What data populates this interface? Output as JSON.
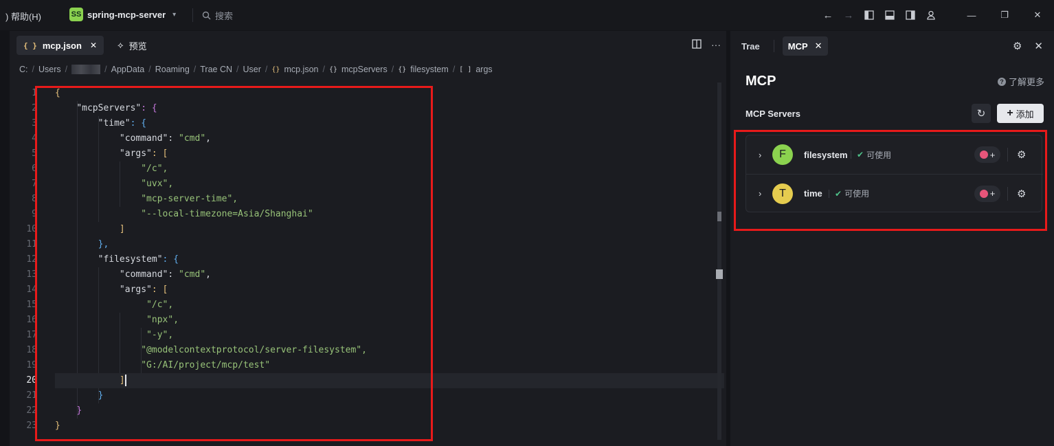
{
  "titlebar": {
    "help_menu": ") 帮助(H)",
    "project_badge": "SS",
    "project_name": "spring-mcp-server",
    "search_label": "搜索"
  },
  "editor": {
    "tabs": [
      {
        "label": "mcp.json",
        "icon": "braces-icon",
        "active": true
      },
      {
        "label": "预览",
        "icon": "preview-icon",
        "active": false
      }
    ],
    "breadcrumb": {
      "drive": "C:",
      "users": "Users",
      "appdata": "AppData",
      "roaming": "Roaming",
      "trae": "Trae CN",
      "user": "User",
      "file": "mcp.json",
      "node1": "mcpServers",
      "node2": "filesystem",
      "node3": "args"
    },
    "current_line": 20,
    "lines": [
      "1",
      "2",
      "3",
      "4",
      "5",
      "6",
      "7",
      "8",
      "9",
      "10",
      "11",
      "12",
      "13",
      "14",
      "15",
      "16",
      "17",
      "18",
      "19",
      "20",
      "21",
      "22",
      "23"
    ],
    "code": {
      "l1": "{",
      "l2_key": "\"mcpServers\"",
      "l2_rest": ": {",
      "l3_key": "\"time\"",
      "l3_rest": ": {",
      "l4_key": "\"command\"",
      "l4_val": "\"cmd\"",
      "l5_key": "\"args\"",
      "l5_rest": ": [",
      "l6": "\"/c\",",
      "l7": "\"uvx\",",
      "l8": "\"mcp-server-time\",",
      "l9": "\"--local-timezone=Asia/Shanghai\"",
      "l10": "]",
      "l11": "},",
      "l12_key": "\"filesystem\"",
      "l12_rest": ": {",
      "l13_key": "\"command\"",
      "l13_val": "\"cmd\"",
      "l14_key": "\"args\"",
      "l14_rest": ": [",
      "l15": "\"/c\",",
      "l16": "\"npx\",",
      "l17": "\"-y\",",
      "l18": "\"@modelcontextprotocol/server-filesystem\",",
      "l19": "\"G:/AI/project/mcp/test\"",
      "l20": "]",
      "l21": "}",
      "l22": "}",
      "l23": "}"
    }
  },
  "panel": {
    "tabs": [
      {
        "label": "Trae",
        "active": false
      },
      {
        "label": "MCP",
        "active": true
      }
    ],
    "title": "MCP",
    "learn_more": "了解更多",
    "servers_label": "MCP Servers",
    "add_label": "添加",
    "servers": [
      {
        "initial": "F",
        "name": "filesystem",
        "status": "可使用",
        "avatar_color": "#8bd24f"
      },
      {
        "initial": "T",
        "name": "time",
        "status": "可使用",
        "avatar_color": "#e5cc4f"
      }
    ]
  },
  "colors": {
    "annotation_box": "#e81a1a",
    "status_ok": "#4fc28a"
  }
}
